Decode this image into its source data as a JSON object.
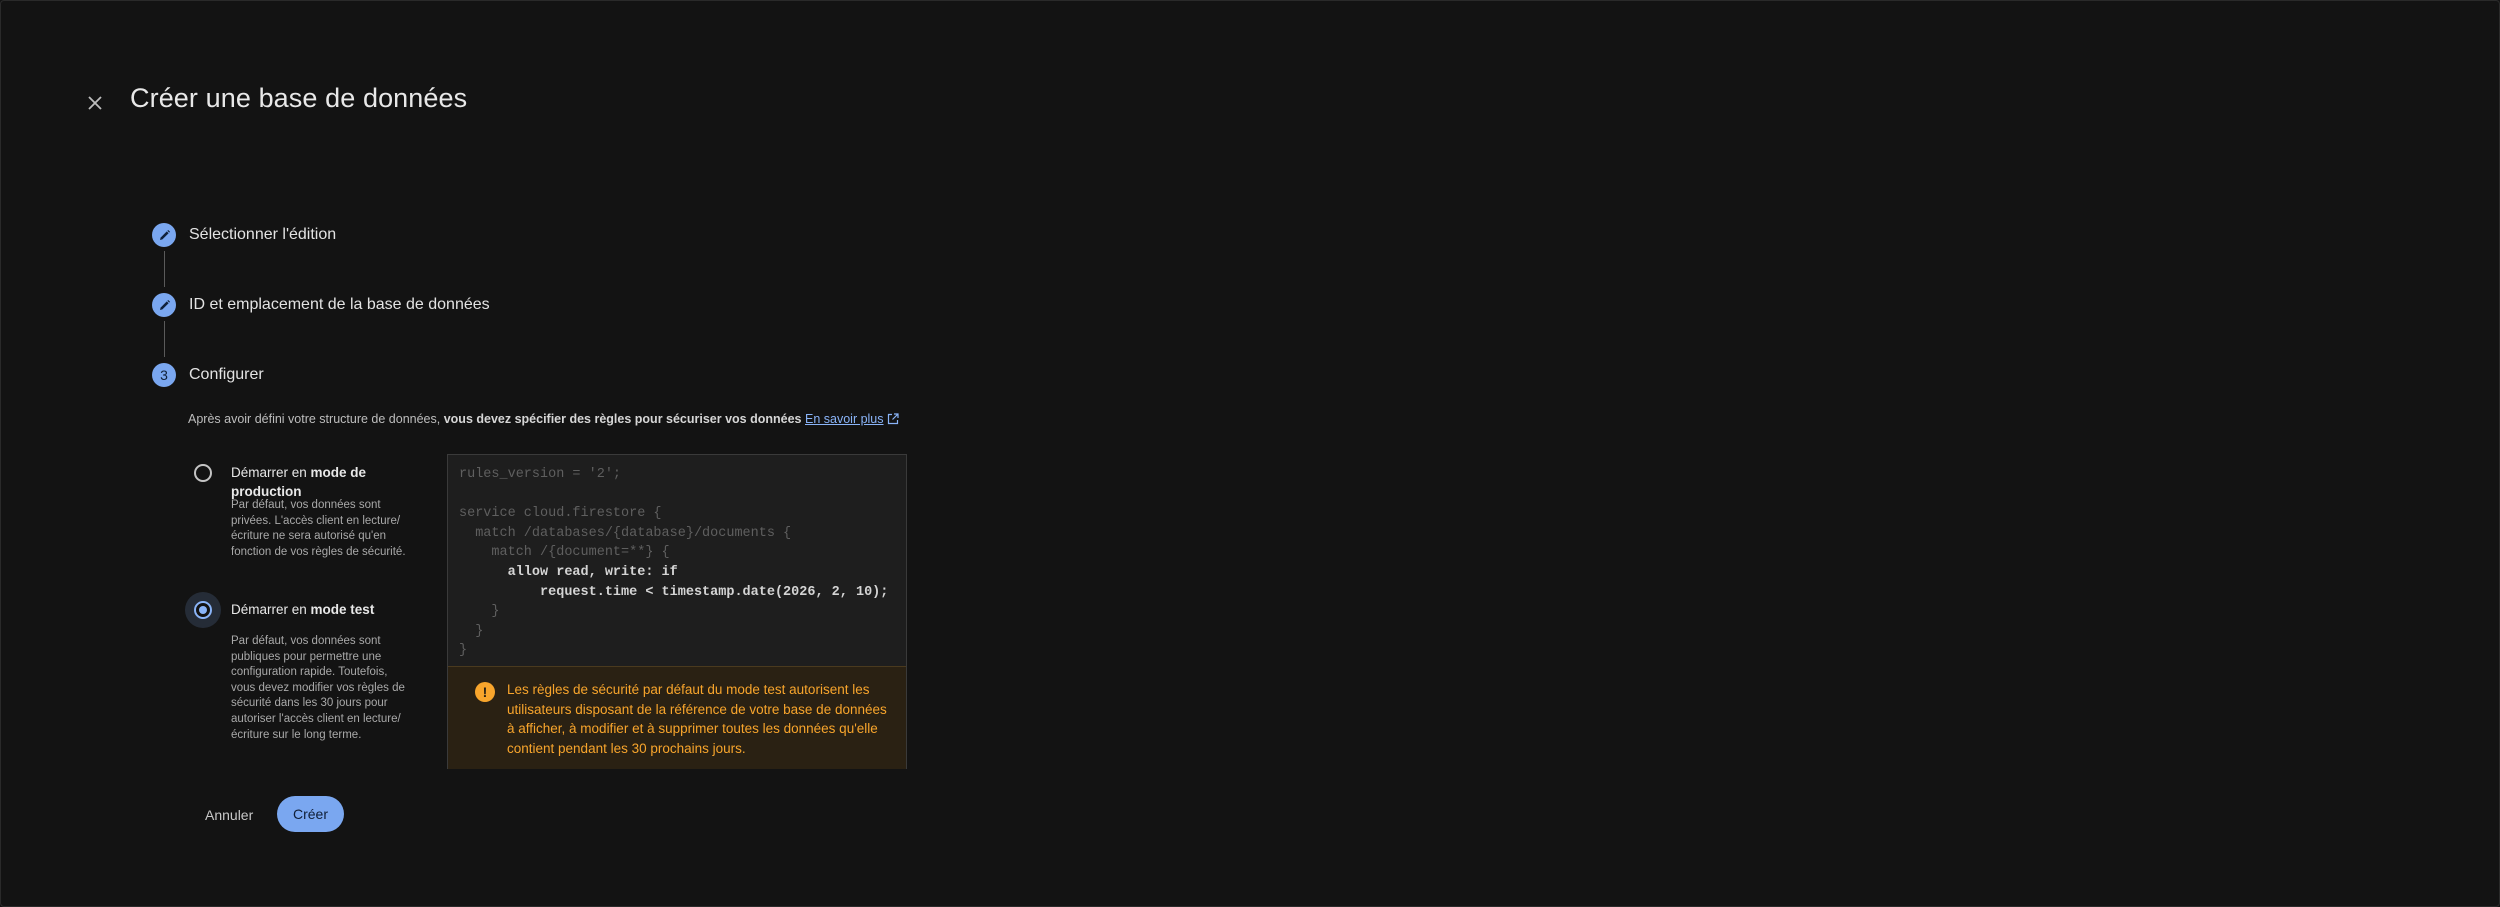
{
  "dialog": {
    "title": "Créer une base de données",
    "close_icon": "close-icon"
  },
  "stepper": {
    "steps": [
      {
        "label": "Sélectionner l'édition",
        "indicator": "edit-icon",
        "state": "completed"
      },
      {
        "label": "ID et emplacement de la base de données",
        "indicator": "edit-icon",
        "state": "completed"
      },
      {
        "label": "Configurer",
        "indicator": "3",
        "state": "active"
      }
    ]
  },
  "configure": {
    "desc_prefix": "Après avoir défini votre structure de données,",
    "desc_bold": "vous devez spécifier des règles pour sécuriser vos données",
    "learn_more": "En savoir plus",
    "options": [
      {
        "title_prefix": "Démarrer en",
        "title_bold": "mode de production",
        "description": "Par défaut, vos données sont privées. L'accès client en lecture/ écriture ne sera autorisé qu'en fonction de vos règles de sécurité.",
        "selected": false
      },
      {
        "title_prefix": "Démarrer en",
        "title_bold": "mode test",
        "description": "Par défaut, vos données sont publiques pour permettre une configuration rapide. Toutefois, vous devez modifier vos règles de sécurité dans les 30 jours pour autoriser l'accès client en lecture/ écriture sur le long terme.",
        "selected": true
      }
    ],
    "code_lines": [
      {
        "text": "rules_version = '2';",
        "highlight": false
      },
      {
        "text": "",
        "highlight": false
      },
      {
        "text": "service cloud.firestore {",
        "highlight": false
      },
      {
        "text": "  match /databases/{database}/documents {",
        "highlight": false
      },
      {
        "text": "    match /{document=**} {",
        "highlight": false
      },
      {
        "text": "      allow read, write: if",
        "highlight": true
      },
      {
        "text": "          request.time < timestamp.date(2026, 2, 10);",
        "highlight": true
      },
      {
        "text": "    }",
        "highlight": false
      },
      {
        "text": "  }",
        "highlight": false
      },
      {
        "text": "}",
        "highlight": false
      }
    ],
    "warning": "Les règles de sécurité par défaut du mode test autorisent les utilisateurs disposant de la référence de votre base de données à afficher, à modifier et à supprimer toutes les données qu'elle contient pendant les 30 prochains jours.",
    "warning_icon": "warning-icon"
  },
  "actions": {
    "cancel": "Annuler",
    "create": "Créer"
  },
  "colors": {
    "background": "#131313",
    "accent": "#7aa7f0",
    "warning": "#f8a52c"
  }
}
